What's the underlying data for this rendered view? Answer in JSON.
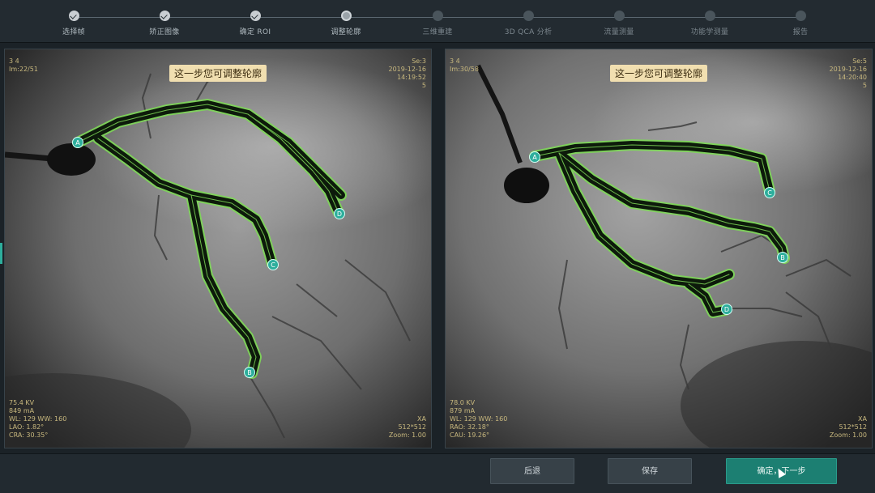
{
  "steps": [
    {
      "label": "选择帧",
      "state": "done"
    },
    {
      "label": "矫正图像",
      "state": "done"
    },
    {
      "label": "确定 ROI",
      "state": "done"
    },
    {
      "label": "调整轮廓",
      "state": "current"
    },
    {
      "label": "三维重建",
      "state": "todo"
    },
    {
      "label": "3D QCA 分析",
      "state": "todo"
    },
    {
      "label": "流量测量",
      "state": "todo"
    },
    {
      "label": "功能学测量",
      "state": "todo"
    },
    {
      "label": "报告",
      "state": "todo"
    }
  ],
  "left_panel": {
    "tip": "这一步您可调整轮廓",
    "top_left": [
      "3 4",
      "Im:22/51"
    ],
    "top_right": [
      "Se:3",
      "2019-12-16",
      "14:19:52",
      "5"
    ],
    "bottom_left": [
      "75.4 KV",
      "849 mA",
      "WL: 129 WW: 160",
      "LAO: 1.82°",
      "CRA: 30.35°"
    ],
    "bottom_right": [
      "XA",
      "512*512",
      "Zoom: 1.00"
    ],
    "markers": [
      "A",
      "D",
      "C",
      "B"
    ]
  },
  "right_panel": {
    "tip": "这一步您可调整轮廓",
    "top_left": [
      "3 4",
      "Im:30/58"
    ],
    "top_right": [
      "Se:5",
      "2019-12-16",
      "14:20:40",
      "5"
    ],
    "bottom_left": [
      "78.0 KV",
      "879 mA",
      "WL: 129 WW: 160",
      "RAO: 32.18°",
      "CAU: 19.26°"
    ],
    "bottom_right": [
      "XA",
      "512*512",
      "Zoom: 1.00"
    ],
    "markers": [
      "A",
      "C",
      "B",
      "D"
    ]
  },
  "buttons": {
    "back": "后退",
    "save": "保存",
    "next": "确定，下一步"
  },
  "colors": {
    "accent": "#1c7f72",
    "contour": "#7ed957",
    "marker": "#2dae9c"
  }
}
